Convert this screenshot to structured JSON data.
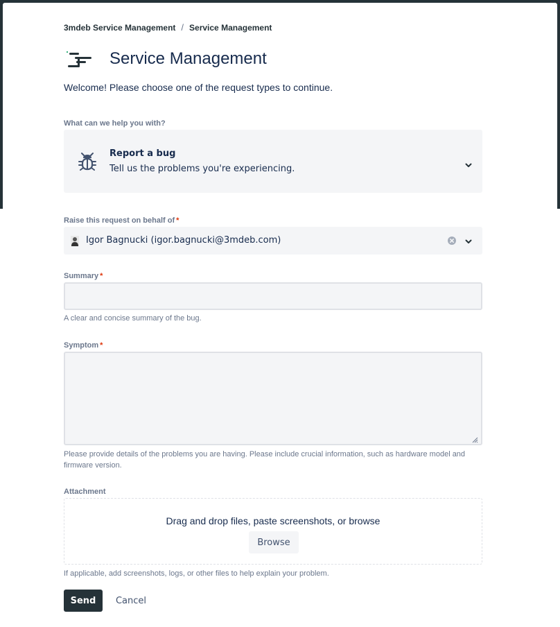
{
  "breadcrumb": {
    "items": [
      "3mdeb Service Management",
      "Service Management"
    ],
    "separator": "/"
  },
  "header": {
    "title": "Service Management",
    "logo_icon": "service-desk-logo-icon"
  },
  "welcome_text": "Welcome! Please choose one of the request types to continue.",
  "request_type": {
    "label": "What can we help you with?",
    "selected_name": "Report a bug",
    "selected_description": "Tell us the problems you're experiencing.",
    "icon": "bug-icon"
  },
  "behalf": {
    "label": "Raise this request on behalf of",
    "required_mark": "*",
    "value": "Igor Bagnucki (igor.bagnucki@3mdeb.com)"
  },
  "summary": {
    "label": "Summary",
    "required_mark": "*",
    "value": "",
    "helper": "A clear and concise summary of the bug."
  },
  "symptom": {
    "label": "Symptom",
    "required_mark": "*",
    "value": "",
    "helper": "Please provide details of the problems you are having. Please include crucial information, such as hardware model and firmware version."
  },
  "attachment": {
    "label": "Attachment",
    "dropzone_text": "Drag and drop files, paste screenshots, or browse",
    "browse_label": "Browse",
    "helper": "If applicable, add screenshots, logs, or other files to help explain your problem."
  },
  "actions": {
    "send_label": "Send",
    "cancel_label": "Cancel"
  },
  "colors": {
    "banner": "#253238",
    "primary_button": "#253238",
    "required": "#de350b",
    "field_background": "#f4f5f7",
    "text": "#172b4d",
    "subtle_text": "#6b778c"
  }
}
